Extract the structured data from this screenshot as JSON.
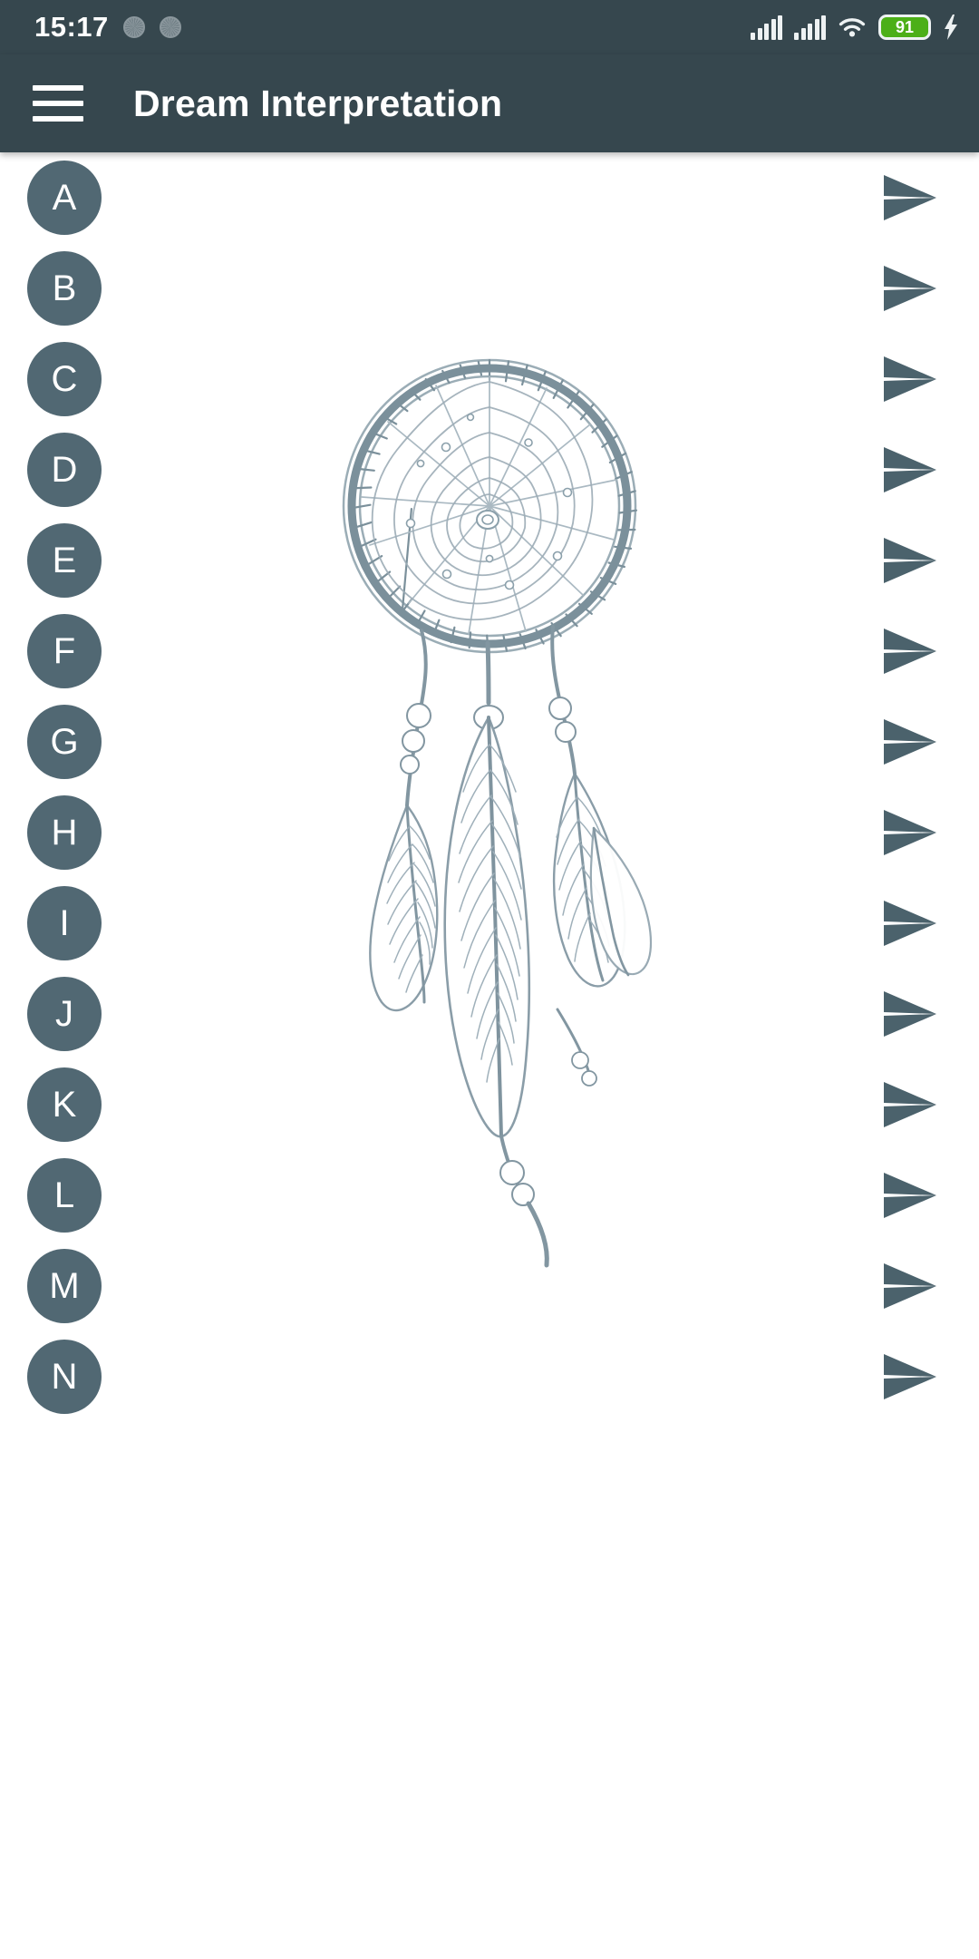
{
  "status_bar": {
    "time": "15:17",
    "icons": [
      "sync-dot-icon",
      "sync-dot-icon",
      "signal-bars-icon",
      "signal-bars-icon",
      "wifi-icon",
      "battery-icon",
      "charging-bolt-icon"
    ],
    "battery_level": "91",
    "battery_color": "#4caf18"
  },
  "toolbar": {
    "menu_icon": "hamburger-menu-icon",
    "title": "Dream Interpretation",
    "background_color": "#36474e"
  },
  "theme": {
    "primary": "#36474e",
    "badge": "#516873",
    "arrow": "#4b626c",
    "page_background": "#ffffff"
  },
  "main": {
    "artwork": {
      "name": "dreamcatcher-illustration",
      "description": "Pencil sketch of a dreamcatcher with hoop, woven web, beads and three hanging feathers",
      "stroke_color": "#7c8f99"
    },
    "letters": [
      {
        "label": "A",
        "action_icon": "send-arrow-icon"
      },
      {
        "label": "B",
        "action_icon": "send-arrow-icon"
      },
      {
        "label": "C",
        "action_icon": "send-arrow-icon"
      },
      {
        "label": "D",
        "action_icon": "send-arrow-icon"
      },
      {
        "label": "E",
        "action_icon": "send-arrow-icon"
      },
      {
        "label": "F",
        "action_icon": "send-arrow-icon"
      },
      {
        "label": "G",
        "action_icon": "send-arrow-icon"
      },
      {
        "label": "H",
        "action_icon": "send-arrow-icon"
      },
      {
        "label": "I",
        "action_icon": "send-arrow-icon"
      },
      {
        "label": "J",
        "action_icon": "send-arrow-icon"
      },
      {
        "label": "K",
        "action_icon": "send-arrow-icon"
      },
      {
        "label": "L",
        "action_icon": "send-arrow-icon"
      },
      {
        "label": "M",
        "action_icon": "send-arrow-icon"
      },
      {
        "label": "N",
        "action_icon": "send-arrow-icon"
      }
    ]
  }
}
